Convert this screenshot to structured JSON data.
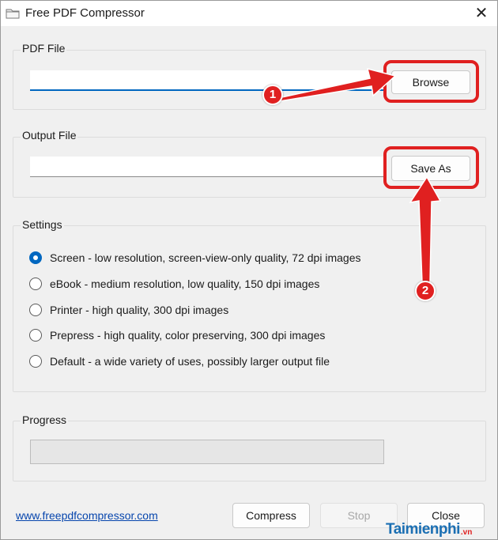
{
  "window": {
    "title": "Free PDF Compressor",
    "close_glyph": "✕",
    "app_icon": "folder-icon"
  },
  "pdf_file": {
    "group_label": "PDF File",
    "value": "",
    "browse_label": "Browse"
  },
  "output_file": {
    "group_label": "Output File",
    "value": "",
    "save_as_label": "Save As"
  },
  "settings": {
    "group_label": "Settings",
    "selected_index": 0,
    "options": [
      "Screen - low resolution, screen-view-only quality, 72 dpi images",
      "eBook - medium resolution, low quality, 150 dpi images",
      "Printer - high quality, 300 dpi images",
      "Prepress - high quality, color preserving, 300 dpi images",
      "Default - a wide variety of uses, possibly larger output file"
    ]
  },
  "progress": {
    "group_label": "Progress",
    "fraction": 0
  },
  "footer": {
    "link_text": "www.freepdfcompressor.com",
    "compress_label": "Compress",
    "stop_label": "Stop",
    "close_label": "Close"
  },
  "annotations": {
    "badge_1": "1",
    "badge_2": "2",
    "accent_color": "#e02020"
  },
  "watermark": {
    "text": "Taimienphi",
    "suffix": ".vn"
  }
}
